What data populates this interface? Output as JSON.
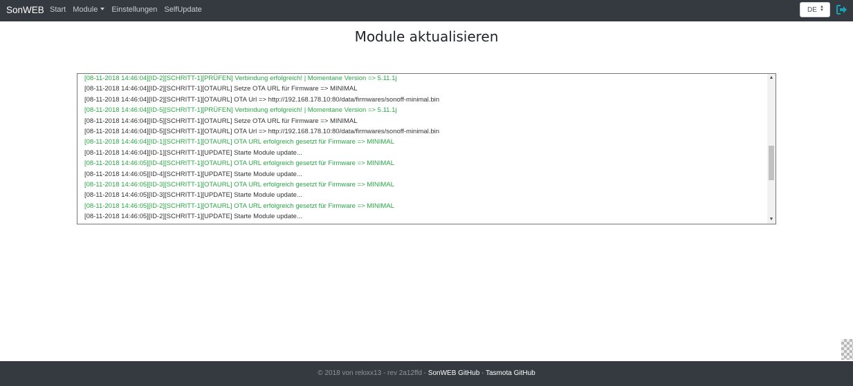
{
  "navbar": {
    "brand": "SonWEB",
    "links": [
      {
        "label": "Start"
      },
      {
        "label": "Module",
        "dropdown": true
      },
      {
        "label": "Einstellungen"
      },
      {
        "label": "SelfUpdate"
      }
    ],
    "language": "DE",
    "logout_icon": "logout-icon"
  },
  "page": {
    "title": "Module aktualisieren"
  },
  "log": {
    "lines": [
      {
        "text": "[08-11-2018 14:46:04][ID-2][SCHRITT-1][PRÜFEN] Verbindung erfolgreich! | Momentane Version => 5.11.1j",
        "status": "ok"
      },
      {
        "text": "[08-11-2018 14:46:04][ID-2][SCHRITT-1][OTAURL] Setze OTA URL für Firmware => MINIMAL",
        "status": "info"
      },
      {
        "text": "[08-11-2018 14:46:04][ID-2][SCHRITT-1][OTAURL] OTA Url => http://192.168.178.10:80/data/firmwares/sonoff-minimal.bin",
        "status": "info"
      },
      {
        "text": "[08-11-2018 14:46:04][ID-5][SCHRITT-1][PRÜFEN] Verbindung erfolgreich! | Momentane Version => 5.11.1j",
        "status": "ok"
      },
      {
        "text": "[08-11-2018 14:46:04][ID-5][SCHRITT-1][OTAURL] Setze OTA URL für Firmware => MINIMAL",
        "status": "info"
      },
      {
        "text": "[08-11-2018 14:46:04][ID-5][SCHRITT-1][OTAURL] OTA Url => http://192.168.178.10:80/data/firmwares/sonoff-minimal.bin",
        "status": "info"
      },
      {
        "text": "[08-11-2018 14:46:04][ID-1][SCHRITT-1][OTAURL] OTA URL erfolgreich gesetzt für Firmware => MINIMAL",
        "status": "ok"
      },
      {
        "text": "[08-11-2018 14:46:04][ID-1][SCHRITT-1][UPDATE] Starte Module update...",
        "status": "info"
      },
      {
        "text": "[08-11-2018 14:46:05][ID-4][SCHRITT-1][OTAURL] OTA URL erfolgreich gesetzt für Firmware => MINIMAL",
        "status": "ok"
      },
      {
        "text": "[08-11-2018 14:46:05][ID-4][SCHRITT-1][UPDATE] Starte Module update...",
        "status": "info"
      },
      {
        "text": "[08-11-2018 14:46:05][ID-3][SCHRITT-1][OTAURL] OTA URL erfolgreich gesetzt für Firmware => MINIMAL",
        "status": "ok"
      },
      {
        "text": "[08-11-2018 14:46:05][ID-3][SCHRITT-1][UPDATE] Starte Module update...",
        "status": "info"
      },
      {
        "text": "[08-11-2018 14:46:05][ID-2][SCHRITT-1][OTAURL] OTA URL erfolgreich gesetzt für Firmware => MINIMAL",
        "status": "ok"
      },
      {
        "text": "[08-11-2018 14:46:05][ID-2][SCHRITT-1][UPDATE] Starte Module update...",
        "status": "info"
      }
    ]
  },
  "footer": {
    "copyright": "© 2018 von reloxx13 - rev 2a12ffd - ",
    "link1": "SonWEB GitHub",
    "separator": " - ",
    "link2": "Tasmota GitHub"
  },
  "colors": {
    "navbar_bg": "#343a40",
    "success_text": "#28a745",
    "logout_icon": "#17a2b8"
  }
}
